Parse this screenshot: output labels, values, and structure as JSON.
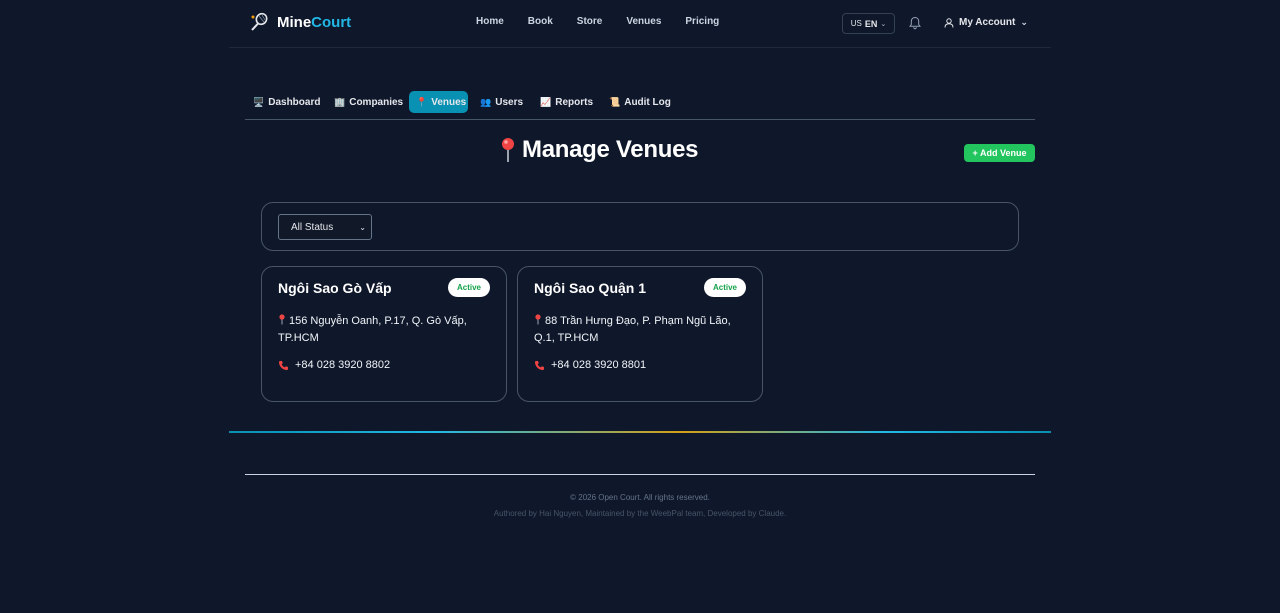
{
  "header": {
    "logo_part1": "Mine",
    "logo_part2": "Court",
    "nav": [
      "Home",
      "Book",
      "Store",
      "Venues",
      "Pricing"
    ],
    "lang_flag": "US",
    "lang_code": "EN",
    "account_label": "My Account"
  },
  "tabs": [
    {
      "icon": "🖥️",
      "label": "Dashboard"
    },
    {
      "icon": "🏢",
      "label": "Companies"
    },
    {
      "icon": "📍",
      "label": "Venues"
    },
    {
      "icon": "👥",
      "label": "Users"
    },
    {
      "icon": "📈",
      "label": "Reports"
    },
    {
      "icon": "📜",
      "label": "Audit Log"
    }
  ],
  "active_tab": "Venues",
  "page": {
    "title": "Manage Venues",
    "add_button": "+ Add Venue"
  },
  "filter": {
    "status_selected": "All Status"
  },
  "venues": [
    {
      "name": "Ngôi Sao Gò Vấp",
      "status": "Active",
      "address": "156 Nguyễn Oanh, P.17, Q. Gò Vấp, TP.HCM",
      "phone": "+84 028 3920 8802"
    },
    {
      "name": "Ngôi Sao Quận 1",
      "status": "Active",
      "address": "88 Trần Hưng Đạo, P. Phạm Ngũ Lão, Q.1, TP.HCM",
      "phone": "+84 028 3920 8801"
    }
  ],
  "footer": {
    "copyright": "© 2026 Open Court. All rights reserved.",
    "credits": "Authored by Hai Nguyen, Maintained by the WeebPal team, Developed by Claude."
  },
  "colors": {
    "background": "#0f172a",
    "accent": "#0891b2",
    "logo_accent": "#22b8e6",
    "success": "#22c55e"
  },
  "icons": {
    "logo": "badminton-racket-icon",
    "pin": "location-pin-icon",
    "phone": "phone-icon",
    "bell": "bell-icon",
    "user": "user-icon"
  }
}
